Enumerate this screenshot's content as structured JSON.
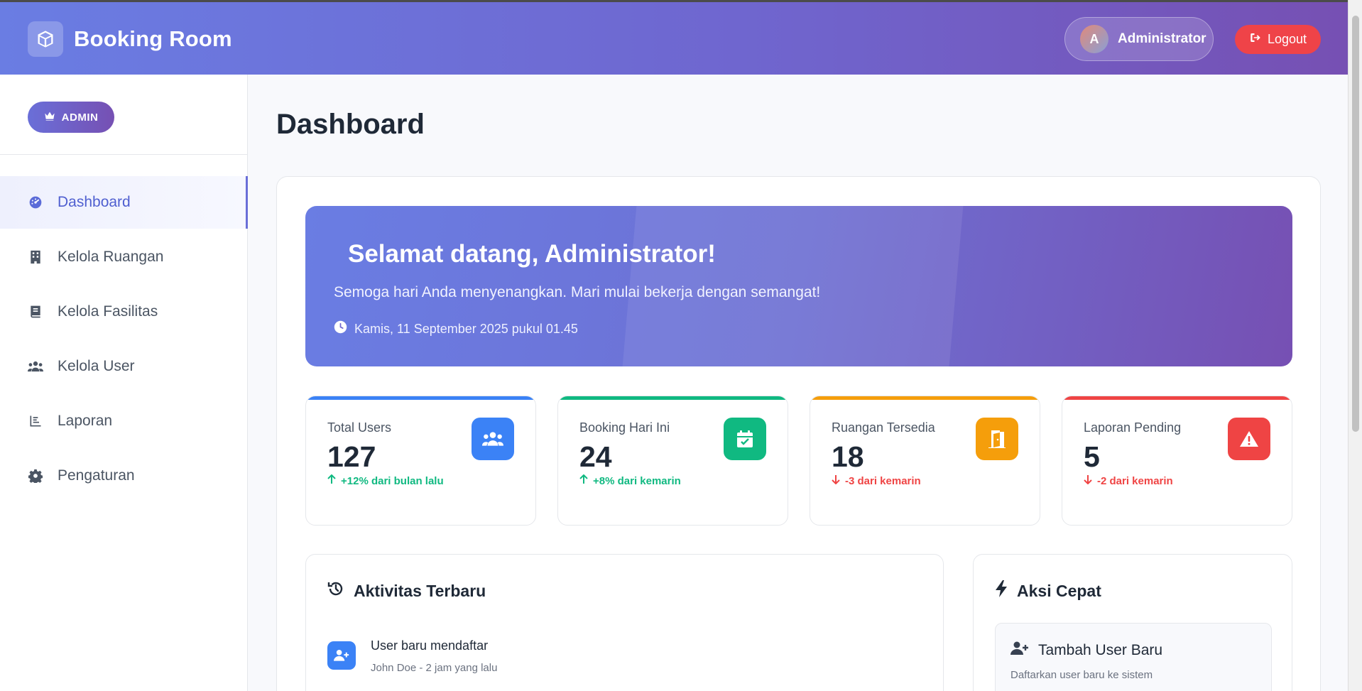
{
  "header": {
    "brand": "Booking Room",
    "user": {
      "initial": "A",
      "name": "Administrator"
    },
    "logout_label": "Logout"
  },
  "sidebar": {
    "badge": "ADMIN",
    "items": [
      {
        "label": "Dashboard",
        "icon": "dashboard-icon",
        "active": true
      },
      {
        "label": "Kelola Ruangan",
        "icon": "building-icon"
      },
      {
        "label": "Kelola Fasilitas",
        "icon": "book-icon"
      },
      {
        "label": "Kelola User",
        "icon": "users-icon"
      },
      {
        "label": "Laporan",
        "icon": "chart-icon"
      },
      {
        "label": "Pengaturan",
        "icon": "gear-icon"
      }
    ]
  },
  "main": {
    "title": "Dashboard",
    "welcome": {
      "title": "Selamat datang, Administrator!",
      "subtitle": "Semoga hari Anda menyenangkan. Mari mulai bekerja dengan semangat!",
      "datetime": "Kamis, 11 September 2025 pukul 01.45"
    },
    "stats": [
      {
        "label": "Total Users",
        "value": "127",
        "change": "+12% dari bulan lalu",
        "trend": "up",
        "color": "#3b82f6",
        "icon": "users-icon"
      },
      {
        "label": "Booking Hari Ini",
        "value": "24",
        "change": "+8% dari kemarin",
        "trend": "up",
        "color": "#10b981",
        "icon": "calendar-check-icon"
      },
      {
        "label": "Ruangan Tersedia",
        "value": "18",
        "change": "-3 dari kemarin",
        "trend": "down",
        "color": "#f59e0b",
        "icon": "door-icon"
      },
      {
        "label": "Laporan Pending",
        "value": "5",
        "change": "-2 dari kemarin",
        "trend": "down",
        "color": "#ef4444",
        "icon": "warning-icon"
      }
    ],
    "activity": {
      "title": "Aktivitas Terbaru",
      "items": [
        {
          "title": "User baru mendaftar",
          "meta": "John Doe - 2 jam yang lalu"
        }
      ]
    },
    "quick_actions": {
      "title": "Aksi Cepat",
      "items": [
        {
          "title": "Tambah User Baru",
          "desc": "Daftarkan user baru ke sistem"
        }
      ]
    }
  }
}
